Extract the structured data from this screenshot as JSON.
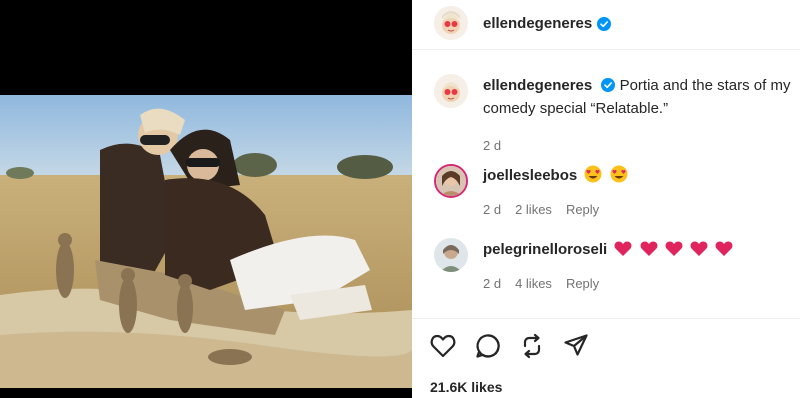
{
  "header": {
    "username": "ellendegeneres",
    "avatar_icon": "ellen-avatar-icon",
    "verified_icon": "verified-badge-icon"
  },
  "comments": [
    {
      "author": "ellendegeneres",
      "text": "Portia and the stars of my comedy special “Relatable.”",
      "time": "2 d",
      "verified": true,
      "avatar_icon": "ellen-avatar-icon"
    },
    {
      "author": "joellesleebos",
      "emojis": [
        "heart-eyes-emoji",
        "heart-eyes-emoji"
      ],
      "time": "2 d",
      "likes": "2 likes",
      "reply": "Reply",
      "avatar_icon": "joelle-avatar-icon"
    },
    {
      "author": "pelegrinelloroseli",
      "emojis": [
        "red-heart-emoji",
        "red-heart-emoji",
        "red-heart-emoji",
        "red-heart-emoji",
        "red-heart-emoji"
      ],
      "time": "2 d",
      "likes": "4 likes",
      "reply": "Reply",
      "avatar_icon": "pelegrinello-avatar-icon"
    }
  ],
  "actions": {
    "like_icon": "heart-icon",
    "comment_icon": "comment-icon",
    "repost_icon": "repost-icon",
    "share_icon": "share-icon"
  },
  "post_likes": "21.6K likes",
  "colors": {
    "verified_blue": "#0095f6",
    "text_primary": "#262626",
    "text_secondary": "#737373",
    "heart_red": "#e0245e"
  }
}
